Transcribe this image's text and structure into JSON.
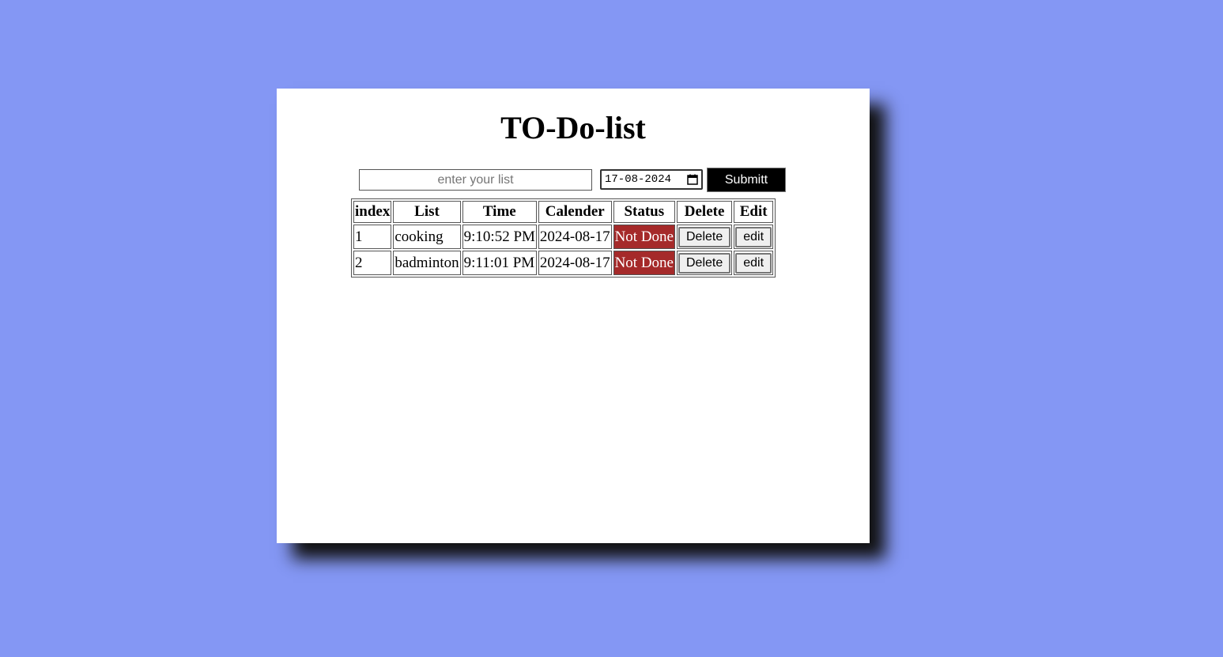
{
  "app": {
    "title": "TO-Do-list"
  },
  "form": {
    "list_placeholder": "enter your list",
    "list_value": "",
    "date_value": "17-08-2024",
    "submit_label": "Submitt",
    "calendar_icon": "calendar-icon"
  },
  "table": {
    "headers": [
      "index",
      "List",
      "Time",
      "Calender",
      "Status",
      "Delete",
      "Edit"
    ],
    "rows": [
      {
        "index": "1",
        "list": "cooking",
        "time": "9:10:52 PM",
        "calendar": "2024-08-17",
        "status": "Not Done",
        "delete_label": "Delete",
        "edit_label": "edit"
      },
      {
        "index": "2",
        "list": "badminton",
        "time": "9:11:01 PM",
        "calendar": "2024-08-17",
        "status": "Not Done",
        "delete_label": "Delete",
        "edit_label": "edit"
      }
    ]
  },
  "colors": {
    "page_background": "#8497f4",
    "card_background": "#ffffff",
    "submit_background": "#000000",
    "status_not_done": "#a52a2a"
  }
}
